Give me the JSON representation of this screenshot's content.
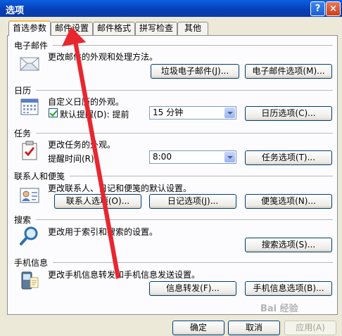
{
  "window": {
    "title": "选项",
    "help_glyph": "?",
    "close_glyph": "×"
  },
  "tabs": [
    "首选参数",
    "邮件设置",
    "邮件格式",
    "拼写检查",
    "其他"
  ],
  "sections": {
    "email": {
      "title": "电子邮件",
      "desc": "更改邮件的外观和处理方法。",
      "junk_button": "垃圾电子邮件(J)...",
      "options_button": "电子邮件选项(M)..."
    },
    "calendar": {
      "title": "日历",
      "desc": "自定义日历的外观。",
      "reminder_label": "默认提醒(D): 提前",
      "reminder_value": "15 分钟",
      "options_button": "日历选项(C)..."
    },
    "tasks": {
      "title": "任务",
      "desc": "更改任务的外观。",
      "reminder_label": "提醒时间(R):",
      "reminder_value": "8:00",
      "options_button": "任务选项(T)..."
    },
    "contacts": {
      "title": "联系人和便笺",
      "desc": "更改联系人、日记和便笺的默认设置。",
      "contact_button": "联系人选项(O)...",
      "journal_button": "日记选项(J)...",
      "notes_button": "便笺选项(N)..."
    },
    "search": {
      "title": "搜索",
      "desc": "更改用于索引和搜索的设置。",
      "options_button": "搜索选项(S)..."
    },
    "mobile": {
      "title": "手机信息",
      "desc": "更改手机信息转发和手机信息发送设置。",
      "forward_button": "信息转发(F)...",
      "options_button": "手机信息选项(B)..."
    }
  },
  "footer": {
    "ok": "确定",
    "cancel": "取消",
    "apply": "应用(A)"
  },
  "watermark": "Bai 经验"
}
